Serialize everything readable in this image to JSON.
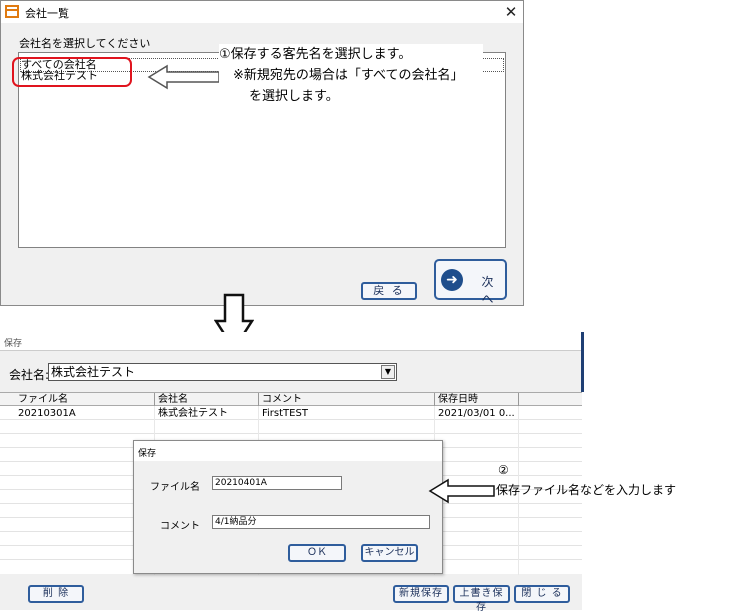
{
  "window1": {
    "title": "会社一覧",
    "prompt": "会社名を選択してください",
    "list_items": [
      "すべての会社名",
      "株式会社テスト"
    ],
    "back_button": "戻 る",
    "next_button": "次 へ"
  },
  "callout1": {
    "line1": "①保存する客先名を選択します。",
    "line2": "※新規宛先の場合は「すべての会社名」",
    "line3": "を選択します。"
  },
  "window2": {
    "title": "保存",
    "company_label": "会社名:",
    "company_value": "株式会社テスト",
    "columns": [
      "ファイル名",
      "会社名",
      "コメント",
      "保存日時"
    ],
    "rows": [
      [
        "20210301A",
        "株式会社テスト",
        "FirstTEST",
        "2021/03/01 0..."
      ]
    ],
    "delete_button": "削 除",
    "new_save_button": "新規保存",
    "overwrite_button": "上書き保存",
    "close_button": "閉 じ る"
  },
  "dialog": {
    "title": "保存",
    "filename_label": "ファイル名",
    "filename_value": "20210401A",
    "comment_label": "コメント",
    "comment_value": "4/1納品分",
    "ok_button": "ＯＫ",
    "cancel_button": "キャンセル"
  },
  "callout2": {
    "number": "②",
    "text": "保存ファイル名などを入力します"
  },
  "colors": {
    "accent_blue": "#2f5d9c",
    "highlight_red": "#e0141e",
    "icon_orange": "#e07a10"
  }
}
